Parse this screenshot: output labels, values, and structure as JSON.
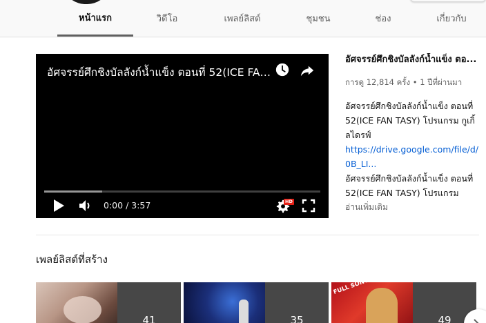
{
  "tabs": [
    {
      "label": "หน้าแรก",
      "active": true
    },
    {
      "label": "วิดีโอ",
      "active": false
    },
    {
      "label": "เพลย์ลิสต์",
      "active": false
    },
    {
      "label": "ชุมชน",
      "active": false
    },
    {
      "label": "ช่อง",
      "active": false
    },
    {
      "label": "เกี่ยวกับ",
      "active": false
    }
  ],
  "player": {
    "title": "อัศจรรย์ศึกชิงบัลลังก์น้ำแข็ง ตอนที่ 52(ICE FAN TASY) โปรแกรม",
    "current_time": "0:00",
    "duration": "3:57",
    "quality_badge": "HD",
    "loaded_fraction": 0.21,
    "icons": [
      "watch-later-icon",
      "share-icon",
      "play-icon",
      "volume-icon",
      "settings-icon",
      "fullscreen-icon"
    ]
  },
  "featured": {
    "title": "อัศจรรย์ศึกชิงบัลลังก์น้ำแข็ง ตอ...",
    "views": "การดู 12,814 ครั้ง",
    "age": "1 ปีที่ผ่านมา",
    "description_1": "อัศจรรย์ศึกชิงบัลลังก์น้ำแข็ง ตอนที่ 52(ICE FAN TASY) โปรแกรม กูเกิ้ลไดรฟ์",
    "link": "https://drive.google.com/file/d/0B_LI...",
    "description_2": "อัศจรรย์ศึกชิงบัลลังก์น้ำแข็ง ตอนที่ 52(ICE FAN TASY) โปรแกรม",
    "read_more": "อ่านเพิ่มเติม"
  },
  "playlists_section": {
    "title": "เพลย์ลิสต์ที่สร้าง",
    "items": [
      {
        "count": "41"
      },
      {
        "count": "35"
      },
      {
        "count": "49",
        "thumb_text": "FULL SONG"
      }
    ]
  },
  "colors": {
    "accent_link": "#065fd4",
    "hd_badge": "#e62117"
  }
}
